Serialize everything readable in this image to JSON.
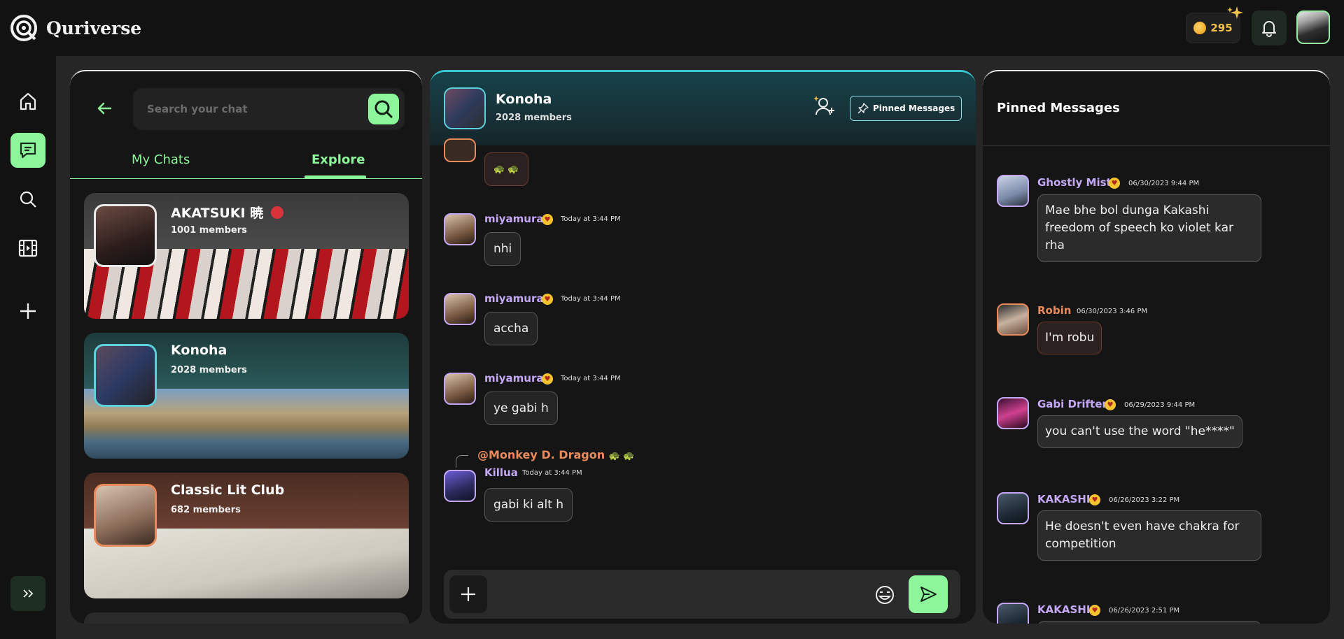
{
  "app": {
    "name": "Quriverse"
  },
  "topbar": {
    "coins": "295"
  },
  "search": {
    "placeholder": "Search your chat"
  },
  "tabs": {
    "my_chats": "My Chats",
    "explore": "Explore"
  },
  "chats": [
    {
      "name": "AKATSUKI 暁",
      "members": "1001 members"
    },
    {
      "name": "Konoha",
      "members": "2028 members"
    },
    {
      "name": "Classic Lit Club",
      "members": "682 members"
    }
  ],
  "chat_header": {
    "name": "Konoha",
    "members": "2028 members",
    "pinned_button": "Pinned Messages"
  },
  "messages": [
    {
      "sender": "miyamura",
      "time": "Today at 3:44 PM",
      "text": "nhi"
    },
    {
      "sender": "miyamura",
      "time": "Today at 3:44 PM",
      "text": "accha"
    },
    {
      "sender": "miyamura",
      "time": "Today at 3:44 PM",
      "text": "ye gabi h"
    },
    {
      "sender": "Killua",
      "time": "Today at 3:44 PM",
      "text": "gabi ki alt h",
      "reply_to": "@Monkey D. Dragon"
    }
  ],
  "pinned": {
    "title": "Pinned Messages",
    "items": [
      {
        "sender": "Ghostly Mist",
        "time": "06/30/2023 9:44 PM",
        "text": "Mae bhe bol dunga Kakashi freedom of speech ko violet kar rha"
      },
      {
        "sender": "Robin",
        "time": "06/30/2023 3:46 PM",
        "text": "I'm robu"
      },
      {
        "sender": "Gabi Drifter",
        "time": "06/29/2023 9:44 PM",
        "text": "you can't use the word \"he****\""
      },
      {
        "sender": "KAKASHI",
        "time": "06/26/2023 3:22 PM",
        "text": "He doesn't even have chakra for competition"
      },
      {
        "sender": "KAKASHI",
        "time": "06/26/2023 2:51 PM",
        "text": ""
      }
    ]
  },
  "colors": {
    "accent": "#8df59a",
    "cyan": "#39c7d0",
    "purple": "#c4a8f6",
    "orange": "#e88a5b"
  }
}
